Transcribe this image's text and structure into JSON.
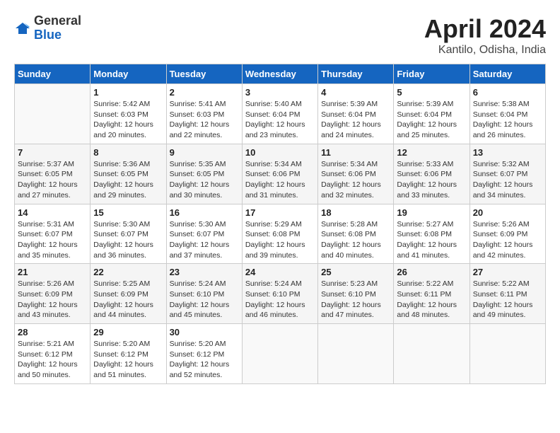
{
  "header": {
    "logo_general": "General",
    "logo_blue": "Blue",
    "month_title": "April 2024",
    "location": "Kantilo, Odisha, India"
  },
  "days_of_week": [
    "Sunday",
    "Monday",
    "Tuesday",
    "Wednesday",
    "Thursday",
    "Friday",
    "Saturday"
  ],
  "weeks": [
    [
      {
        "day": "",
        "empty": true
      },
      {
        "day": "1",
        "sunrise": "Sunrise: 5:42 AM",
        "sunset": "Sunset: 6:03 PM",
        "daylight": "Daylight: 12 hours and 20 minutes."
      },
      {
        "day": "2",
        "sunrise": "Sunrise: 5:41 AM",
        "sunset": "Sunset: 6:03 PM",
        "daylight": "Daylight: 12 hours and 22 minutes."
      },
      {
        "day": "3",
        "sunrise": "Sunrise: 5:40 AM",
        "sunset": "Sunset: 6:04 PM",
        "daylight": "Daylight: 12 hours and 23 minutes."
      },
      {
        "day": "4",
        "sunrise": "Sunrise: 5:39 AM",
        "sunset": "Sunset: 6:04 PM",
        "daylight": "Daylight: 12 hours and 24 minutes."
      },
      {
        "day": "5",
        "sunrise": "Sunrise: 5:39 AM",
        "sunset": "Sunset: 6:04 PM",
        "daylight": "Daylight: 12 hours and 25 minutes."
      },
      {
        "day": "6",
        "sunrise": "Sunrise: 5:38 AM",
        "sunset": "Sunset: 6:04 PM",
        "daylight": "Daylight: 12 hours and 26 minutes."
      }
    ],
    [
      {
        "day": "7",
        "sunrise": "Sunrise: 5:37 AM",
        "sunset": "Sunset: 6:05 PM",
        "daylight": "Daylight: 12 hours and 27 minutes."
      },
      {
        "day": "8",
        "sunrise": "Sunrise: 5:36 AM",
        "sunset": "Sunset: 6:05 PM",
        "daylight": "Daylight: 12 hours and 29 minutes."
      },
      {
        "day": "9",
        "sunrise": "Sunrise: 5:35 AM",
        "sunset": "Sunset: 6:05 PM",
        "daylight": "Daylight: 12 hours and 30 minutes."
      },
      {
        "day": "10",
        "sunrise": "Sunrise: 5:34 AM",
        "sunset": "Sunset: 6:06 PM",
        "daylight": "Daylight: 12 hours and 31 minutes."
      },
      {
        "day": "11",
        "sunrise": "Sunrise: 5:34 AM",
        "sunset": "Sunset: 6:06 PM",
        "daylight": "Daylight: 12 hours and 32 minutes."
      },
      {
        "day": "12",
        "sunrise": "Sunrise: 5:33 AM",
        "sunset": "Sunset: 6:06 PM",
        "daylight": "Daylight: 12 hours and 33 minutes."
      },
      {
        "day": "13",
        "sunrise": "Sunrise: 5:32 AM",
        "sunset": "Sunset: 6:07 PM",
        "daylight": "Daylight: 12 hours and 34 minutes."
      }
    ],
    [
      {
        "day": "14",
        "sunrise": "Sunrise: 5:31 AM",
        "sunset": "Sunset: 6:07 PM",
        "daylight": "Daylight: 12 hours and 35 minutes."
      },
      {
        "day": "15",
        "sunrise": "Sunrise: 5:30 AM",
        "sunset": "Sunset: 6:07 PM",
        "daylight": "Daylight: 12 hours and 36 minutes."
      },
      {
        "day": "16",
        "sunrise": "Sunrise: 5:30 AM",
        "sunset": "Sunset: 6:07 PM",
        "daylight": "Daylight: 12 hours and 37 minutes."
      },
      {
        "day": "17",
        "sunrise": "Sunrise: 5:29 AM",
        "sunset": "Sunset: 6:08 PM",
        "daylight": "Daylight: 12 hours and 39 minutes."
      },
      {
        "day": "18",
        "sunrise": "Sunrise: 5:28 AM",
        "sunset": "Sunset: 6:08 PM",
        "daylight": "Daylight: 12 hours and 40 minutes."
      },
      {
        "day": "19",
        "sunrise": "Sunrise: 5:27 AM",
        "sunset": "Sunset: 6:08 PM",
        "daylight": "Daylight: 12 hours and 41 minutes."
      },
      {
        "day": "20",
        "sunrise": "Sunrise: 5:26 AM",
        "sunset": "Sunset: 6:09 PM",
        "daylight": "Daylight: 12 hours and 42 minutes."
      }
    ],
    [
      {
        "day": "21",
        "sunrise": "Sunrise: 5:26 AM",
        "sunset": "Sunset: 6:09 PM",
        "daylight": "Daylight: 12 hours and 43 minutes."
      },
      {
        "day": "22",
        "sunrise": "Sunrise: 5:25 AM",
        "sunset": "Sunset: 6:09 PM",
        "daylight": "Daylight: 12 hours and 44 minutes."
      },
      {
        "day": "23",
        "sunrise": "Sunrise: 5:24 AM",
        "sunset": "Sunset: 6:10 PM",
        "daylight": "Daylight: 12 hours and 45 minutes."
      },
      {
        "day": "24",
        "sunrise": "Sunrise: 5:24 AM",
        "sunset": "Sunset: 6:10 PM",
        "daylight": "Daylight: 12 hours and 46 minutes."
      },
      {
        "day": "25",
        "sunrise": "Sunrise: 5:23 AM",
        "sunset": "Sunset: 6:10 PM",
        "daylight": "Daylight: 12 hours and 47 minutes."
      },
      {
        "day": "26",
        "sunrise": "Sunrise: 5:22 AM",
        "sunset": "Sunset: 6:11 PM",
        "daylight": "Daylight: 12 hours and 48 minutes."
      },
      {
        "day": "27",
        "sunrise": "Sunrise: 5:22 AM",
        "sunset": "Sunset: 6:11 PM",
        "daylight": "Daylight: 12 hours and 49 minutes."
      }
    ],
    [
      {
        "day": "28",
        "sunrise": "Sunrise: 5:21 AM",
        "sunset": "Sunset: 6:12 PM",
        "daylight": "Daylight: 12 hours and 50 minutes."
      },
      {
        "day": "29",
        "sunrise": "Sunrise: 5:20 AM",
        "sunset": "Sunset: 6:12 PM",
        "daylight": "Daylight: 12 hours and 51 minutes."
      },
      {
        "day": "30",
        "sunrise": "Sunrise: 5:20 AM",
        "sunset": "Sunset: 6:12 PM",
        "daylight": "Daylight: 12 hours and 52 minutes."
      },
      {
        "day": "",
        "empty": true
      },
      {
        "day": "",
        "empty": true
      },
      {
        "day": "",
        "empty": true
      },
      {
        "day": "",
        "empty": true
      }
    ]
  ]
}
